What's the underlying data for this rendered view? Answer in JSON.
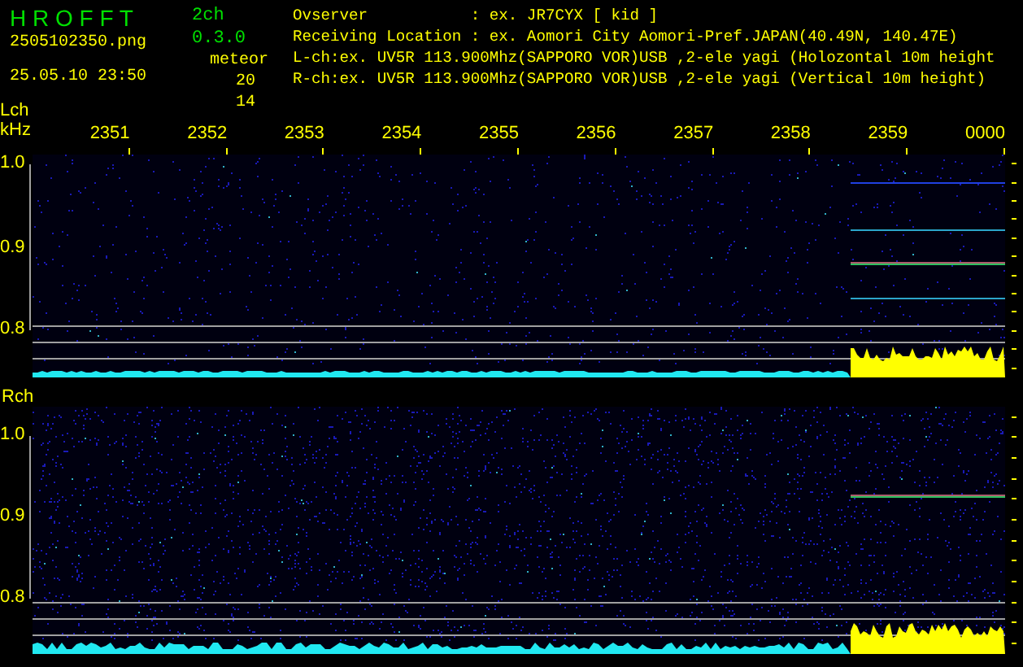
{
  "header": {
    "app_name": "H R O F F T",
    "version": "2ch 0.3.0",
    "filename": "2505102350.png",
    "timestamp": "25.05.10 23:50",
    "counts_label": "meteor",
    "counts": [
      "20",
      "14"
    ]
  },
  "station": [
    {
      "label": "Ovserver",
      "value": ": ex. JR7CYX [ kid ]"
    },
    {
      "label": "Receiving Location",
      "value": ": ex. Aomori City Aomori-Pref.JAPAN(40.49N, 140.47E)"
    }
  ],
  "channel_lines": [
    "L-ch:ex. UV5R 113.900Mhz(SAPPORO VOR)USB ,2-ele yagi (Holozontal 10m height",
    "R-ch:ex. UV5R 113.900Mhz(SAPPORO VOR)USB ,2-ele yagi (Vertical 10m height)"
  ],
  "time_axis": [
    "2351",
    "2352",
    "2353",
    "2354",
    "2355",
    "2356",
    "2357",
    "2358",
    "2359",
    "0000"
  ],
  "panels": [
    {
      "label": "Lch",
      "unit": "kHz",
      "yticks": [
        "1.0",
        "0.9",
        "0.8"
      ]
    },
    {
      "label": "Rch",
      "yticks": [
        "1.0",
        "0.9",
        "0.8"
      ]
    }
  ]
}
